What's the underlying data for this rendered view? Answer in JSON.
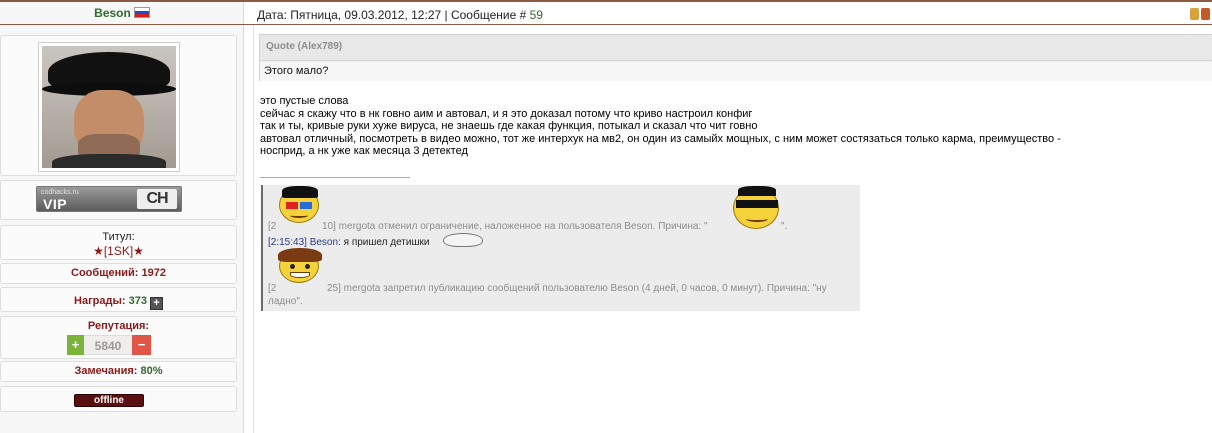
{
  "user": {
    "name": "Beson",
    "badge": {
      "small_text": "codhacks.ru",
      "label": "VIP",
      "logo": "CH"
    },
    "title_label": "Титул:",
    "title_value": "★[1SK]★",
    "posts_label": "Сообщений:",
    "posts_value": "1972",
    "awards_label": "Награды:",
    "awards_value": "373",
    "reputation_label": "Репутация:",
    "reputation_value": "5840",
    "rep_plus": "+",
    "rep_minus": "−",
    "warnings_label": "Замечания:",
    "warnings_value": "80%",
    "status": "offline"
  },
  "post": {
    "header_prefix": "Дата: Пятница, 09.03.2012, 12:27 | Сообщение #",
    "message_number": "59",
    "quote_header": "Quote (Alex789)",
    "quote_body": "Этого мало?",
    "lines": [
      "это пустые слова",
      "сейчас я скажу что в нк говно аим и автовал, и я это доказал потому что криво настроил конфиг",
      "так и ты, кривые руки хуже вируса, не знаешь где какая функция, потыкал и сказал что чит говно",
      "автовал отличный, посмотреть в видео можно, тот же интерхук на мв2, он один из самыйх мощных, с ним может состязаться только карма, преимущество -",
      "носприд, а нк уже как месяца 3 детектед"
    ]
  },
  "signature": {
    "line1_left": "[2",
    "line1_right": "10] mergota отменил ограничение, наложенное на пользователя Beson. Причина: \"",
    "line1_end": "\".",
    "line2_time": "[2:15:43]",
    "line2_user": "Beson:",
    "line2_text": " я пришел детишки",
    "line3_left": "[2",
    "line3_right": "25] mergota запретил публикацию сообщений пользователю Beson (4 дней, 0 часов, 0 минут). Причина: \"ну",
    "line4": "ладно\"."
  },
  "colors": {
    "green": "#2e6b2e",
    "red": "#8a1a1a",
    "rep_plus_bg": "#7cb33a",
    "rep_minus_bg": "#e05545"
  }
}
